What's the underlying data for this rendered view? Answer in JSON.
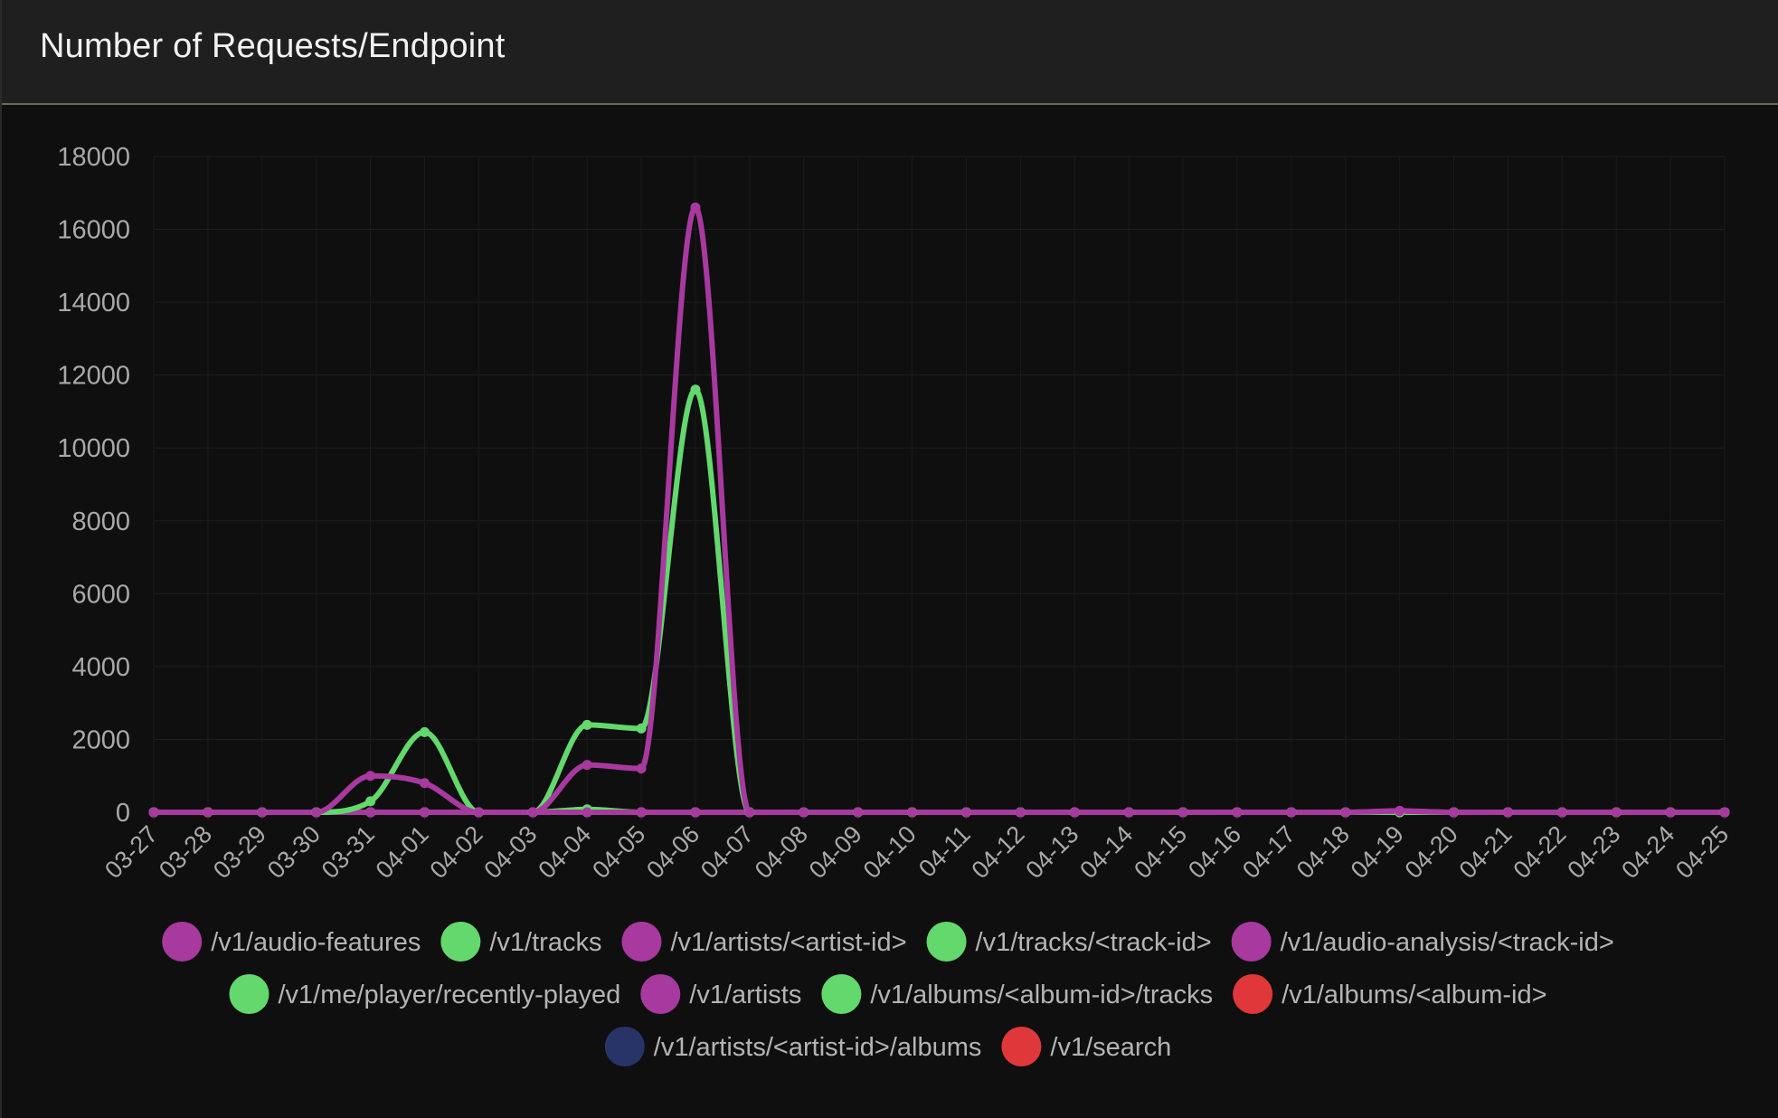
{
  "panel": {
    "title": "Number of Requests/Endpoint"
  },
  "chart_data": {
    "type": "line",
    "title": "Number of Requests/Endpoint",
    "xlabel": "",
    "ylabel": "",
    "ylim": [
      0,
      18000
    ],
    "yticks": [
      0,
      2000,
      4000,
      6000,
      8000,
      10000,
      12000,
      14000,
      16000,
      18000
    ],
    "grid": true,
    "legend_position": "bottom",
    "x": [
      "03-27",
      "03-28",
      "03-29",
      "03-30",
      "03-31",
      "04-01",
      "04-02",
      "04-03",
      "04-04",
      "04-05",
      "04-06",
      "04-07",
      "04-08",
      "04-09",
      "04-10",
      "04-11",
      "04-12",
      "04-13",
      "04-14",
      "04-15",
      "04-16",
      "04-17",
      "04-18",
      "04-19",
      "04-20",
      "04-21",
      "04-22",
      "04-23",
      "04-24",
      "04-25"
    ],
    "series": [
      {
        "name": "/v1/audio-features",
        "color": "#a8399f",
        "values": [
          0,
          0,
          0,
          0,
          1000,
          800,
          0,
          0,
          1300,
          1200,
          16600,
          0,
          0,
          0,
          0,
          0,
          0,
          0,
          0,
          0,
          0,
          0,
          0,
          30,
          0,
          0,
          0,
          0,
          0,
          0
        ]
      },
      {
        "name": "/v1/tracks",
        "color": "#63d86c",
        "values": [
          0,
          0,
          0,
          0,
          300,
          2200,
          0,
          0,
          2400,
          2300,
          11600,
          0,
          0,
          0,
          0,
          0,
          0,
          0,
          0,
          0,
          0,
          0,
          0,
          0,
          0,
          0,
          0,
          0,
          0,
          0
        ]
      },
      {
        "name": "/v1/artists/<artist-id>",
        "color": "#a8399f",
        "values": [
          0,
          0,
          0,
          0,
          0,
          0,
          0,
          0,
          0,
          0,
          0,
          0,
          0,
          0,
          0,
          0,
          0,
          0,
          0,
          0,
          0,
          0,
          0,
          40,
          0,
          0,
          0,
          0,
          0,
          0
        ]
      },
      {
        "name": "/v1/tracks/<track-id>",
        "color": "#63d86c",
        "values": [
          0,
          0,
          0,
          0,
          0,
          0,
          0,
          0,
          80,
          0,
          0,
          0,
          0,
          0,
          0,
          0,
          0,
          0,
          0,
          0,
          0,
          0,
          0,
          0,
          0,
          0,
          0,
          0,
          0,
          0
        ]
      },
      {
        "name": "/v1/audio-analysis/<track-id>",
        "color": "#a8399f",
        "values": [
          0,
          0,
          0,
          0,
          0,
          0,
          0,
          0,
          0,
          0,
          0,
          0,
          0,
          0,
          0,
          0,
          0,
          0,
          0,
          0,
          0,
          0,
          0,
          0,
          0,
          0,
          0,
          0,
          0,
          0
        ]
      },
      {
        "name": "/v1/me/player/recently-played",
        "color": "#63d86c",
        "values": [
          0,
          0,
          0,
          0,
          0,
          0,
          0,
          0,
          0,
          0,
          0,
          0,
          0,
          0,
          0,
          0,
          0,
          0,
          0,
          0,
          0,
          0,
          0,
          0,
          0,
          0,
          0,
          0,
          0,
          0
        ]
      },
      {
        "name": "/v1/artists",
        "color": "#a8399f",
        "values": [
          0,
          0,
          0,
          0,
          0,
          0,
          0,
          0,
          0,
          0,
          0,
          0,
          0,
          0,
          0,
          0,
          0,
          0,
          0,
          0,
          0,
          0,
          0,
          0,
          0,
          0,
          0,
          0,
          0,
          0
        ]
      },
      {
        "name": "/v1/albums/<album-id>/tracks",
        "color": "#63d86c",
        "values": [
          0,
          0,
          0,
          0,
          0,
          0,
          0,
          0,
          0,
          0,
          0,
          0,
          0,
          0,
          0,
          0,
          0,
          0,
          0,
          0,
          0,
          0,
          0,
          0,
          0,
          0,
          0,
          0,
          0,
          0
        ]
      },
      {
        "name": "/v1/albums/<album-id>",
        "color": "#e0373b",
        "values": [
          0,
          0,
          0,
          0,
          0,
          0,
          0,
          0,
          0,
          0,
          0,
          0,
          0,
          0,
          0,
          0,
          0,
          0,
          0,
          0,
          0,
          0,
          0,
          0,
          0,
          0,
          0,
          0,
          0,
          0
        ]
      },
      {
        "name": "/v1/artists/<artist-id>/albums",
        "color": "#283468",
        "values": [
          0,
          0,
          0,
          0,
          0,
          0,
          0,
          0,
          0,
          0,
          0,
          0,
          0,
          0,
          0,
          0,
          0,
          0,
          0,
          0,
          0,
          0,
          0,
          0,
          0,
          0,
          0,
          0,
          0,
          0
        ]
      },
      {
        "name": "/v1/search",
        "color": "#e0373b",
        "values": [
          0,
          0,
          0,
          0,
          0,
          0,
          0,
          0,
          0,
          0,
          0,
          0,
          0,
          0,
          0,
          0,
          0,
          0,
          0,
          0,
          0,
          0,
          0,
          0,
          0,
          0,
          0,
          0,
          0,
          0
        ]
      }
    ]
  }
}
